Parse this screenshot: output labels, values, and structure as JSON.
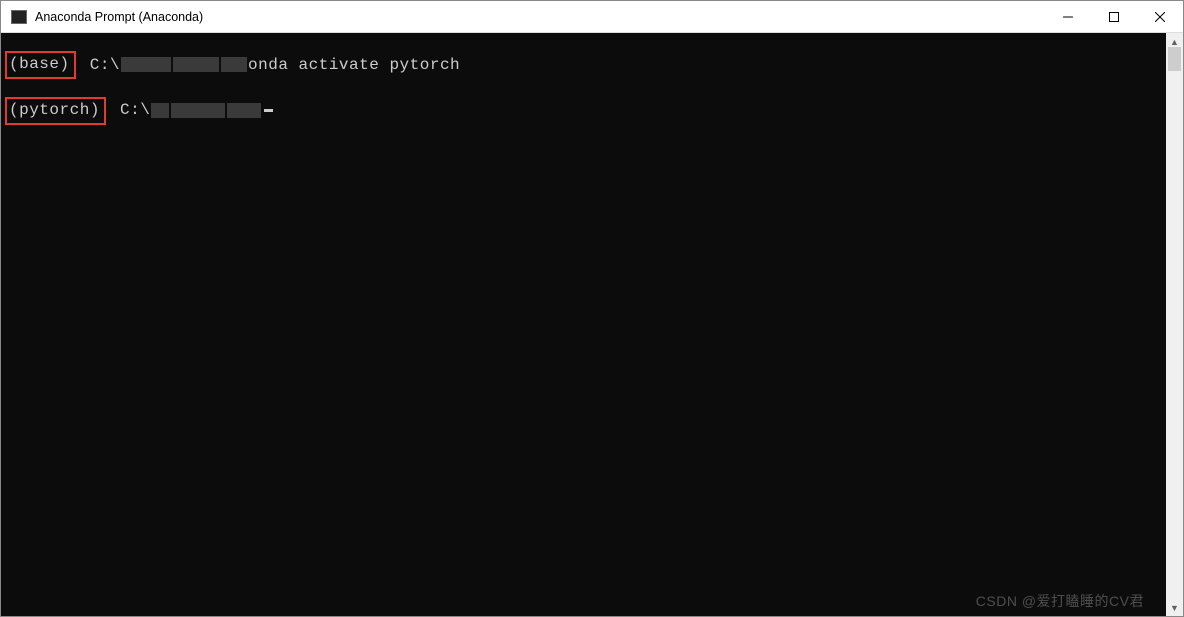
{
  "window": {
    "title": "Anaconda Prompt (Anaconda)"
  },
  "terminal": {
    "lines": [
      {
        "env": "(base)",
        "prefix": " C:\\",
        "command_suffix": "onda activate pytorch"
      },
      {
        "env": "(pytorch)",
        "prefix": " C:\\",
        "command_suffix": ""
      }
    ]
  },
  "watermark": "CSDN @爱打瞌睡的CV君"
}
